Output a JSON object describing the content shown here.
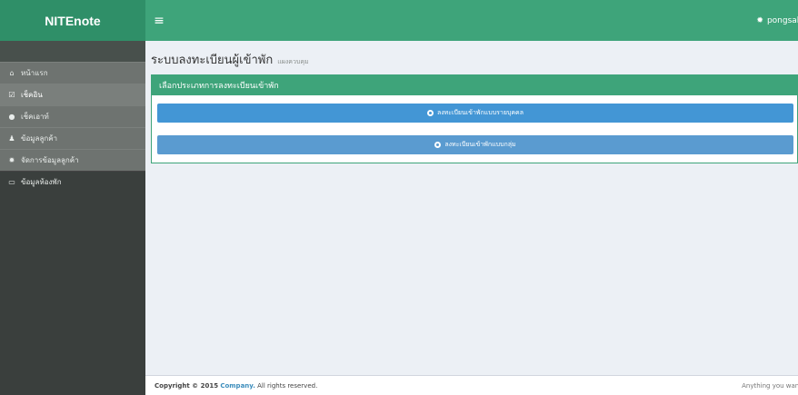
{
  "header": {
    "brand": "NITEnote",
    "toggle_glyph": "≡",
    "user_icon": "gear-icon",
    "user_name": "pongsak"
  },
  "sidebar": {
    "items": [
      {
        "icon": "home-icon",
        "glyph": "⌂",
        "label": "หน้าแรก"
      },
      {
        "icon": "checkbox-icon",
        "glyph": "☑",
        "label": "เช็คอิน"
      },
      {
        "icon": "circle-icon",
        "glyph": "●",
        "label": "เช็คเอาท์"
      },
      {
        "icon": "user-icon",
        "glyph": "♟",
        "label": "ข้อมูลลูกค้า"
      },
      {
        "icon": "gear-icon",
        "glyph": "✹",
        "label": "จัดการข้อมูลลูกค้า"
      },
      {
        "icon": "monitor-icon",
        "glyph": "▭",
        "label": "ข้อมูลห้องพัก"
      }
    ]
  },
  "main": {
    "title": "ระบบลงทะเบียนผู้เข้าพัก",
    "subtitle": "แผงควบคุม",
    "panel_title": "เลือกประเภทการลงทะเบียนเข้าพัก",
    "buttons": [
      {
        "label": "ลงทะเบียนเข้าพักแบบรายบุคคล"
      },
      {
        "label": "ลงทะเบียนเข้าพักแบบกลุ่ม"
      }
    ]
  },
  "footer": {
    "prefix": "Copyright © 2015",
    "company": "Company.",
    "suffix": "All rights reserved.",
    "right_text": "Anything you want"
  },
  "colors": {
    "header": "#3ea47a",
    "logo": "#2f8f68",
    "sidebar": "#3a3f3d",
    "primary_button": "#4396d5",
    "link": "#3c8dbc"
  }
}
